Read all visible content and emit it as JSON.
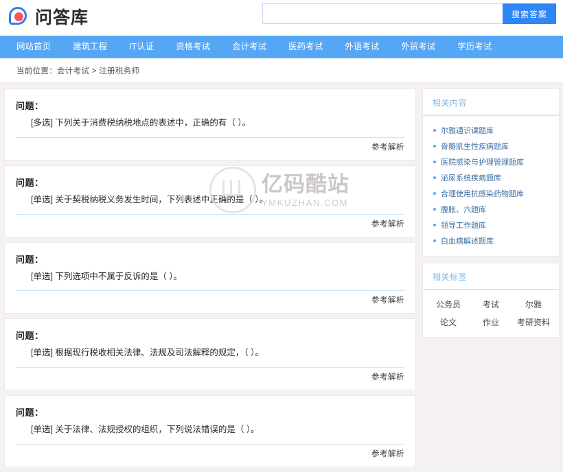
{
  "header": {
    "logo_text": "问答库",
    "search": {
      "value": "",
      "placeholder": "",
      "button_label": "搜索答案"
    }
  },
  "nav": {
    "items": [
      {
        "label": "网站首页"
      },
      {
        "label": "建筑工程"
      },
      {
        "label": "IT认证"
      },
      {
        "label": "资格考试"
      },
      {
        "label": "会计考试"
      },
      {
        "label": "医药考试"
      },
      {
        "label": "外语考试"
      },
      {
        "label": "外贸考试"
      },
      {
        "label": "学历考试"
      }
    ]
  },
  "breadcrumb": {
    "text": "当前位置：会计考试 > 注册税务师"
  },
  "main": {
    "question_label": "问题：",
    "analysis_label": "参考解析",
    "questions": [
      {
        "type": "[多选]",
        "text": "[多选] 下列关于消费税纳税地点的表述中，正确的有（      ）。"
      },
      {
        "type": "[单选]",
        "text": "[单选] 关于契税纳税义务发生时间，下列表述中正确的是（      ）。"
      },
      {
        "type": "[单选]",
        "text": "[单选] 下列选项中不属于反诉的是（      ）。"
      },
      {
        "type": "[单选]",
        "text": "[单选] 根据现行税收相关法律、法规及司法解释的规定，（      ）。"
      },
      {
        "type": "[单选]",
        "text": "[单选] 关于法律、法规授权的组织，下列说法错误的是（      ）。"
      }
    ]
  },
  "sidebar": {
    "related_content": {
      "title": "相关内容",
      "items": [
        {
          "label": "尔雅通识课题库"
        },
        {
          "label": "骨骼肌生性疾病题库"
        },
        {
          "label": "医院感染与护理管理题库"
        },
        {
          "label": "泌尿系统疾病题库"
        },
        {
          "label": "合理使用抗感染药物题库"
        },
        {
          "label": "腹胀、六题库"
        },
        {
          "label": "领导工作题库"
        },
        {
          "label": "白血病解述题库"
        }
      ]
    },
    "related_tags": {
      "title": "相关标签",
      "tags": [
        {
          "label": "公务员"
        },
        {
          "label": "考试"
        },
        {
          "label": "尔雅"
        },
        {
          "label": "论文"
        },
        {
          "label": "作业"
        },
        {
          "label": "考研资料"
        }
      ]
    }
  },
  "watermark": {
    "cn": "亿码酷站",
    "en": "YMKUZHAN.COM"
  },
  "colors": {
    "nav_bg": "#55a6f5",
    "accent": "#2f86f6",
    "page_bg": "#f5f1f2",
    "logo_dot": "#f4565a"
  }
}
